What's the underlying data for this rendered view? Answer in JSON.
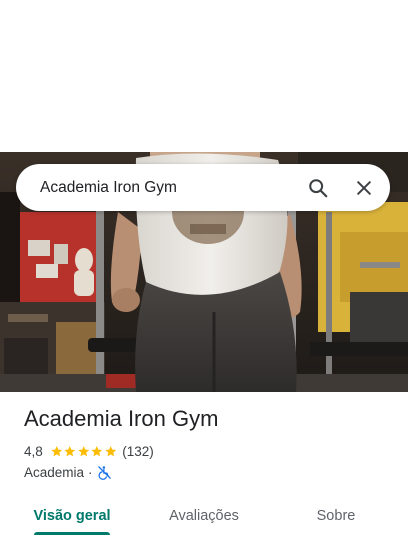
{
  "search": {
    "query": "Academia Iron Gym",
    "search_icon": "search-icon",
    "close_icon": "close-icon"
  },
  "hero": {
    "photo": "gym-photo"
  },
  "place": {
    "name": "Academia Iron Gym",
    "rating": "4,8",
    "stars": 5,
    "review_count": "(132)",
    "category": "Academia",
    "separator": "·",
    "accessibility_icon": "no-wheelchair-access-icon"
  },
  "tabs": [
    {
      "label": "Visão geral",
      "active": true
    },
    {
      "label": "Avaliações",
      "active": false
    },
    {
      "label": "Sobre",
      "active": false
    }
  ],
  "colors": {
    "accent": "#00796b",
    "star": "#fbbc04",
    "text_primary": "#202124",
    "text_secondary": "#3c4043",
    "accessibility_icon": "#1a73e8"
  }
}
